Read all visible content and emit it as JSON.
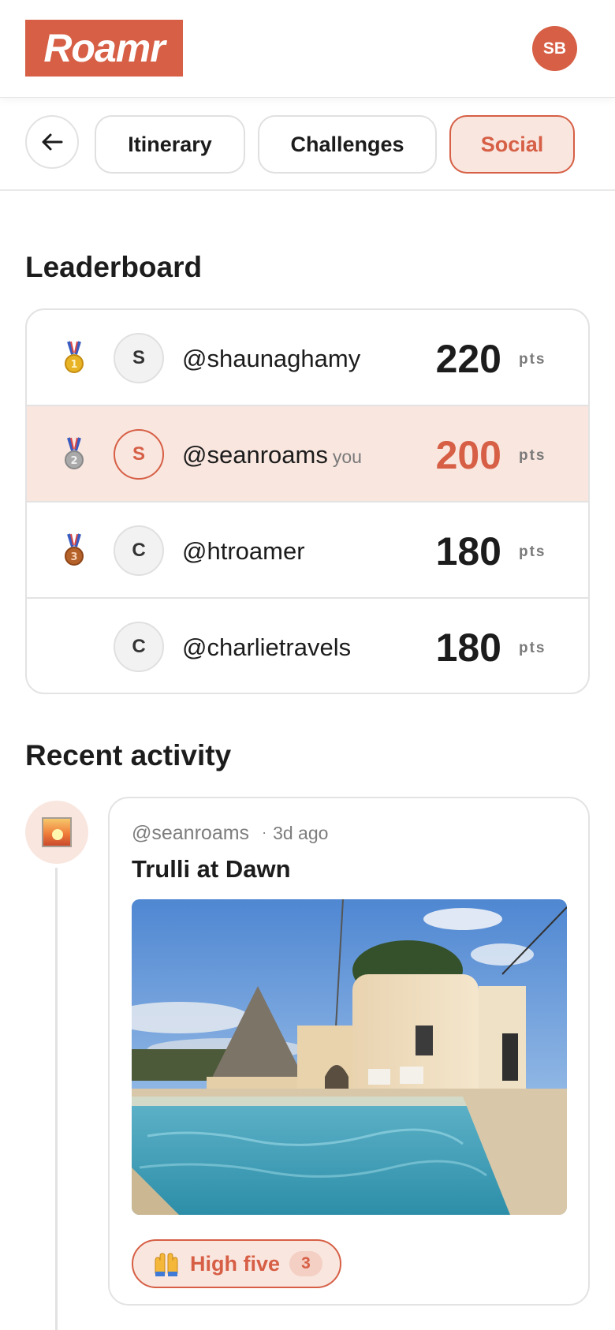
{
  "app": {
    "logo_text": "Roamr",
    "user_initials": "SB",
    "brand_color": "#d65f45"
  },
  "nav": {
    "tabs": [
      {
        "label": "Itinerary",
        "active": false
      },
      {
        "label": "Challenges",
        "active": false
      },
      {
        "label": "Social",
        "active": true
      }
    ]
  },
  "leaderboard": {
    "title": "Leaderboard",
    "rows": [
      {
        "rank": 1,
        "medal": "gold-medal-icon",
        "initial": "S",
        "handle": "@shaunaghamy",
        "you": "",
        "score": "220",
        "unit": "pts"
      },
      {
        "rank": 2,
        "medal": "silver-medal-icon",
        "initial": "S",
        "handle": "@seanroams",
        "you": "you",
        "score": "200",
        "unit": "pts"
      },
      {
        "rank": 3,
        "medal": "bronze-medal-icon",
        "initial": "C",
        "handle": "@htroamer",
        "you": "",
        "score": "180",
        "unit": "pts"
      },
      {
        "rank": 4,
        "medal": "",
        "initial": "C",
        "handle": "@charlietravels",
        "you": "",
        "score": "180",
        "unit": "pts"
      }
    ]
  },
  "activity": {
    "title": "Recent activity",
    "items": [
      {
        "icon": "sunrise-photo-icon",
        "user": "@seanroams",
        "time": "3d ago",
        "title": "Trulli at Dawn",
        "photo": "trulli-pool-photo",
        "reaction_label": "High five",
        "reaction_emoji": "raised-hands-icon",
        "reaction_count": "3"
      }
    ]
  }
}
